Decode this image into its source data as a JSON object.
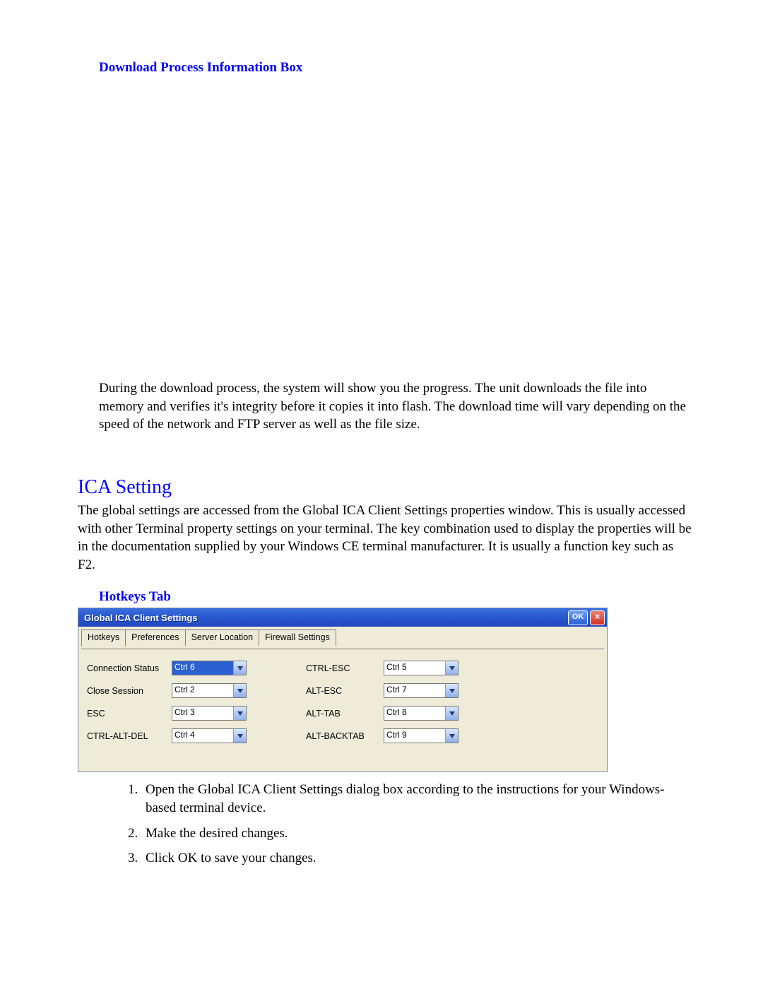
{
  "headings": {
    "download_box": "Download Process Information Box",
    "ica_setting": "ICA Setting",
    "hotkeys_tab": "Hotkeys Tab"
  },
  "paragraphs": {
    "download_desc": "During the download process, the system will show you the progress.  The unit downloads the file into memory and verifies it's integrity before it copies it into flash.  The download time will vary depending on the speed of the network and FTP server as well as the file size.",
    "ica_desc": "The global settings are accessed from the Global ICA Client Settings properties window. This is usually accessed with other Terminal property settings on your terminal. The key combination used to display the properties will be in the documentation supplied by your Windows CE terminal manufacturer. It is usually a function key such as F2."
  },
  "dialog": {
    "title": "Global ICA Client Settings",
    "ok_label": "OK",
    "close_label": "×",
    "tabs": [
      "Hotkeys",
      "Preferences",
      "Server Location",
      "Firewall Settings"
    ],
    "hotkeys": {
      "left": [
        {
          "label": "Connection Status",
          "value": "Ctrl 6",
          "focused": true
        },
        {
          "label": "Close Session",
          "value": "Ctrl 2",
          "focused": false
        },
        {
          "label": "ESC",
          "value": "Ctrl 3",
          "focused": false
        },
        {
          "label": "CTRL-ALT-DEL",
          "value": "Ctrl 4",
          "focused": false
        }
      ],
      "right": [
        {
          "label": "CTRL-ESC",
          "value": "Ctrl 5"
        },
        {
          "label": "ALT-ESC",
          "value": "Ctrl 7"
        },
        {
          "label": "ALT-TAB",
          "value": "Ctrl 8"
        },
        {
          "label": "ALT-BACKTAB",
          "value": "Ctrl 9"
        }
      ]
    }
  },
  "steps": [
    "Open the Global ICA Client Settings dialog box according to the instructions for your Windows-based terminal device.",
    "Make the desired changes.",
    "Click OK to save your changes."
  ]
}
